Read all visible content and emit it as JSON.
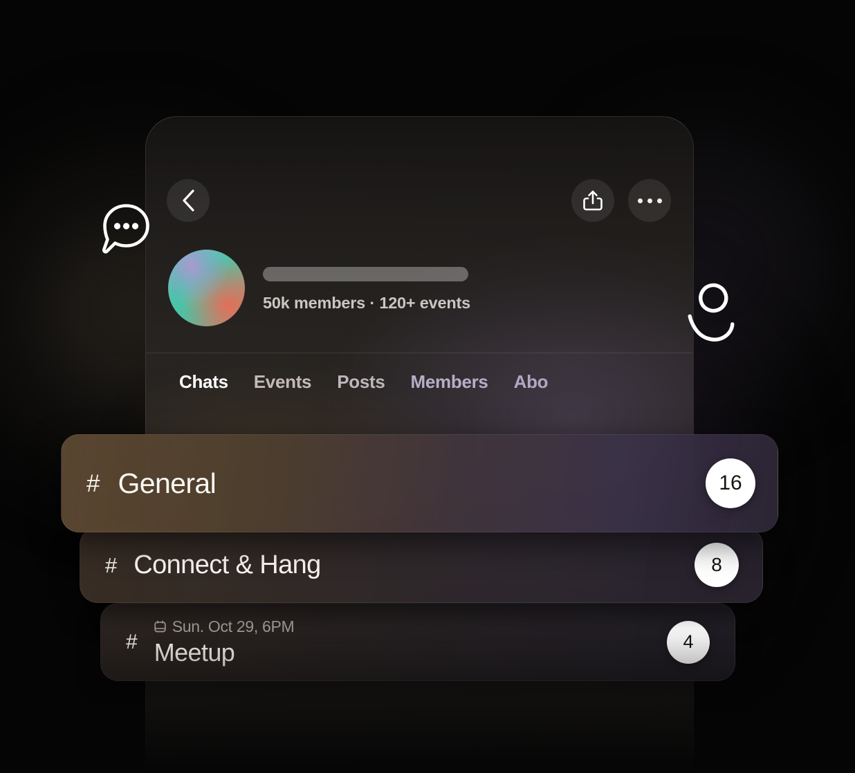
{
  "window": {
    "background_color": "#050505",
    "frame_color": "#262320"
  },
  "header": {
    "back_icon": "chevron-left-icon",
    "share_icon": "share-up-icon",
    "more_icon": "ellipsis-icon"
  },
  "group": {
    "avatar_icon": "gradient-sphere-avatar",
    "title_placeholder": "",
    "meta": "50k members · 120+ events",
    "members_count": "50k members",
    "events_count": "120+ events"
  },
  "tabs": {
    "active": "Chats",
    "items": [
      {
        "label": "Chats",
        "active": true
      },
      {
        "label": "Events",
        "active": false
      },
      {
        "label": "Posts",
        "active": false
      },
      {
        "label": "Members",
        "active": false
      },
      {
        "label": "Abo",
        "active": false
      }
    ]
  },
  "channels": [
    {
      "hash": "#",
      "name": "General",
      "badge": "16",
      "date": null
    },
    {
      "hash": "#",
      "name": "Connect & Hang",
      "badge": "8",
      "date": null
    },
    {
      "hash": "#",
      "name": "Meetup",
      "badge": "4",
      "date": "Sun. Oct 29, 6PM",
      "date_icon": "calendar-icon"
    }
  ],
  "decorations": {
    "chat_bubble_icon": "chat-bubble-typing-icon",
    "person_icon": "person-icon"
  },
  "colors": {
    "badge_bg": "#ffffff",
    "badge_text": "#17140f",
    "active_tab": "#ffffff",
    "inactive_tab": "#bdb5c6",
    "channel_name": "#fbf8f3",
    "meta_text": "#cbc6c2",
    "date_text": "#a6a09a"
  }
}
